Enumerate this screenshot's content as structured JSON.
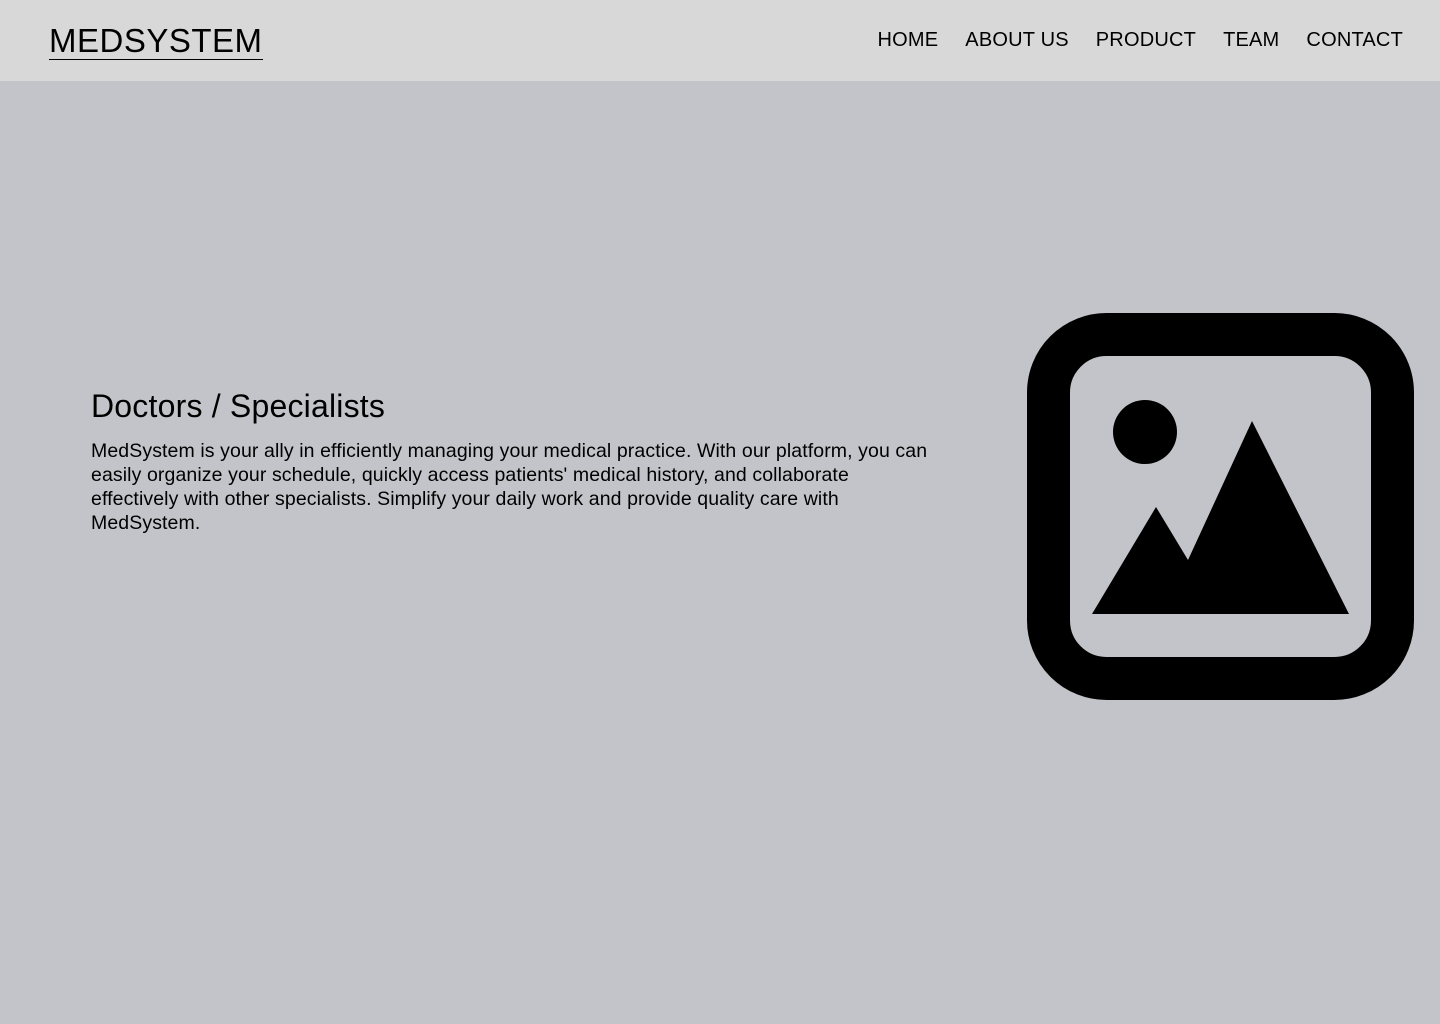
{
  "header": {
    "logo": "MEDSYSTEM",
    "nav": [
      {
        "label": "HOME"
      },
      {
        "label": "ABOUT US"
      },
      {
        "label": "PRODUCT"
      },
      {
        "label": "TEAM"
      },
      {
        "label": "CONTACT"
      }
    ]
  },
  "hero": {
    "title": "Doctors / Specialists",
    "description": "MedSystem is your ally in efficiently managing your medical practice. With our platform, you can easily organize your schedule, quickly access patients' medical history, and collaborate effectively with other specialists. Simplify your daily work and provide quality care with MedSystem.",
    "image_icon": "image-placeholder-icon"
  },
  "colors": {
    "page_background": "#c3c4c9",
    "header_background": "#d8d8d8",
    "text": "#000000"
  }
}
